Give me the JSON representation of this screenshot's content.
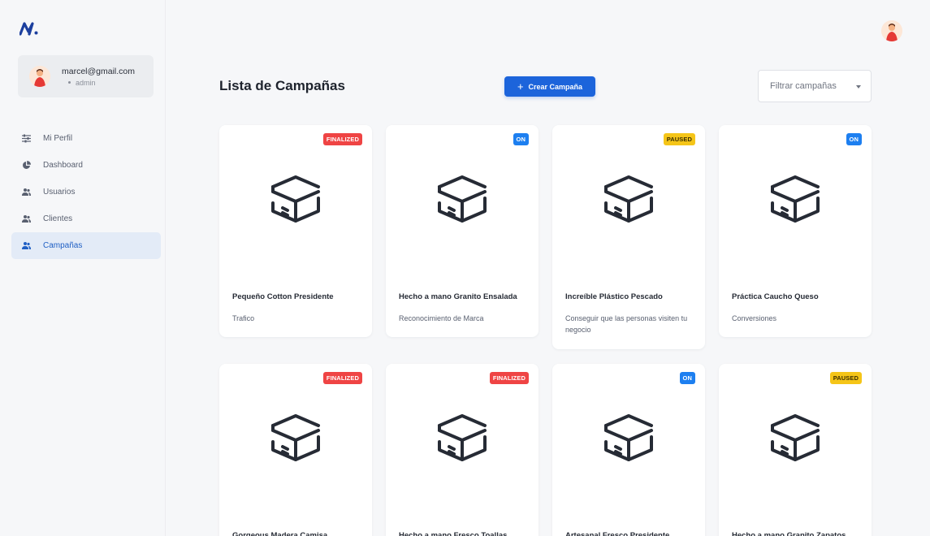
{
  "sidebar": {
    "user": {
      "email": "marcel@gmail.com",
      "role": "admin"
    },
    "nav": [
      {
        "label": "Mi Perfil",
        "icon": "sliders-icon",
        "active": false
      },
      {
        "label": "Dashboard",
        "icon": "pie-chart-icon",
        "active": false
      },
      {
        "label": "Usuarios",
        "icon": "users-icon",
        "active": false
      },
      {
        "label": "Clientes",
        "icon": "users-icon",
        "active": false
      },
      {
        "label": "Campañas",
        "icon": "users-icon",
        "active": true
      }
    ]
  },
  "header": {
    "title": "Lista de Campañas",
    "create_label": "Crear Campaña",
    "filter_placeholder": "Filtrar campañas"
  },
  "campaigns": [
    {
      "name": "Pequeño Cotton Presidente",
      "objective": "Trafico",
      "status": "FINALIZED"
    },
    {
      "name": "Hecho a mano Granito Ensalada",
      "objective": "Reconocimiento de Marca",
      "status": "ON"
    },
    {
      "name": "Increíble Plástico Pescado",
      "objective": "Conseguir que las personas visiten tu negocio",
      "status": "PAUSED"
    },
    {
      "name": "Práctica Caucho Queso",
      "objective": "Conversiones",
      "status": "ON"
    },
    {
      "name": "Gorgeous Madera Camisa",
      "objective": "",
      "status": "FINALIZED"
    },
    {
      "name": "Hecho a mano Fresco Toallas",
      "objective": "",
      "status": "FINALIZED"
    },
    {
      "name": "Artesanal Fresco Presidente",
      "objective": "",
      "status": "ON"
    },
    {
      "name": "Hecho a mano Granito Zapatos",
      "objective": "",
      "status": "PAUSED"
    }
  ],
  "colors": {
    "primary": "#1c64db",
    "finalized": "#ef4444",
    "on": "#1d7ff0",
    "paused": "#f5c518",
    "nav_active_bg": "#e3ebf7"
  }
}
